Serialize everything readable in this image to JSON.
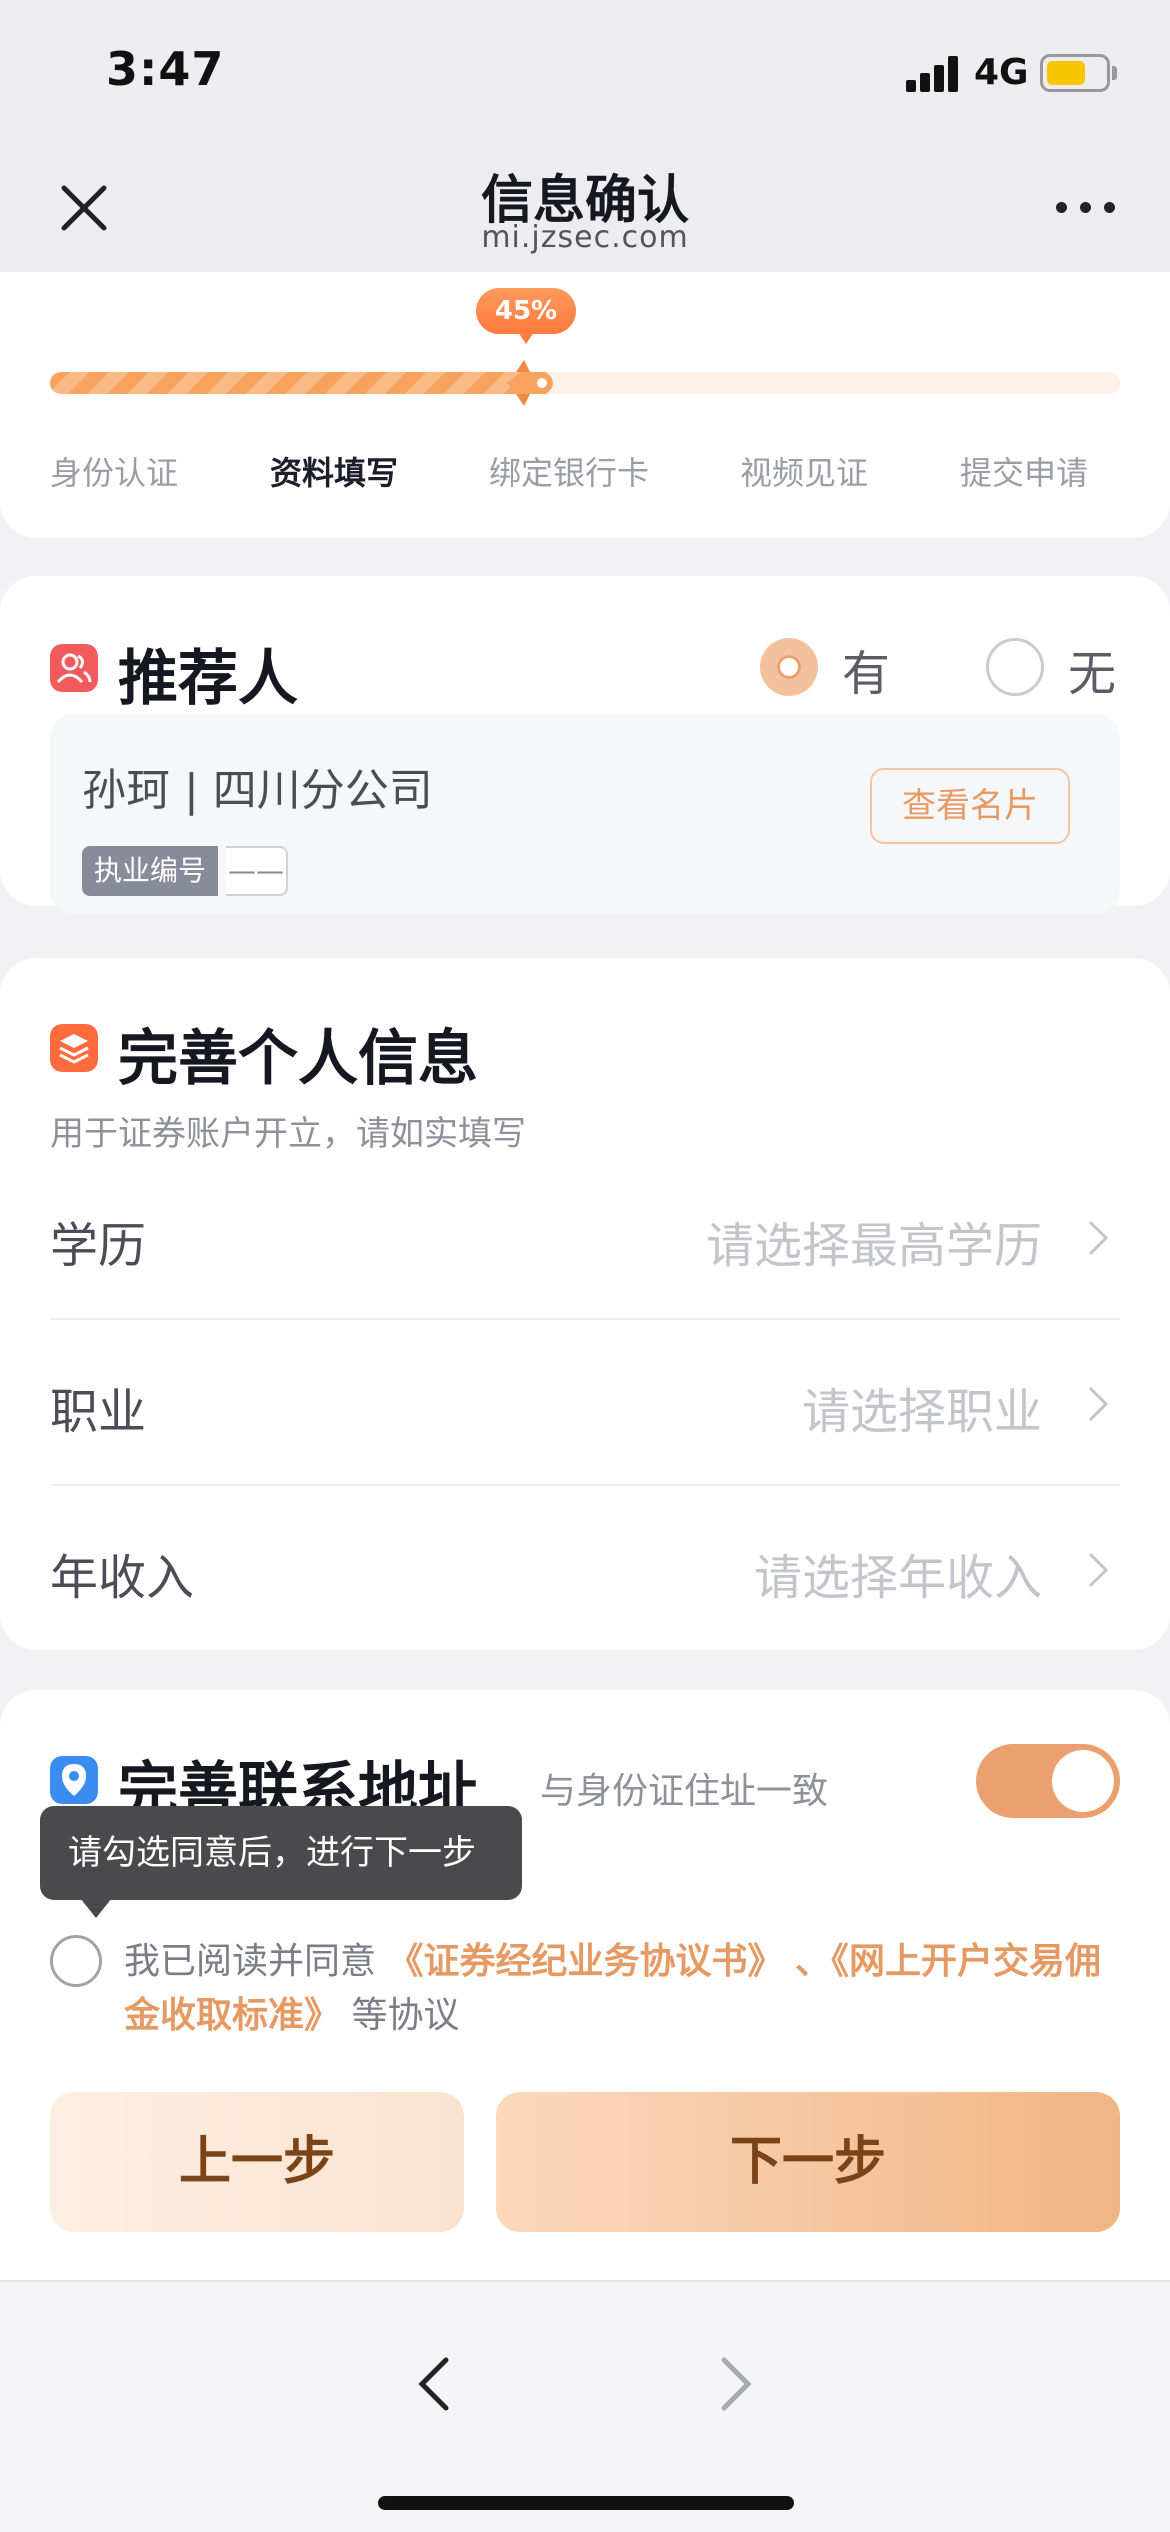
{
  "status_bar": {
    "time": "3:47",
    "network": "4G",
    "battery_color": "#f7c600"
  },
  "nav": {
    "title": "信息确认",
    "url": "mi.jzsec.com",
    "close_icon": "close-icon",
    "more_icon": "more-icon"
  },
  "progress": {
    "percent_label": "45%",
    "value": 0.45,
    "steps": [
      "身份认证",
      "资料填写",
      "绑定银行卡",
      "视频见证",
      "提交申请"
    ],
    "active_step": 1
  },
  "referrer": {
    "title": "推荐人",
    "option_yes": "有",
    "option_no": "无",
    "selected": "有",
    "name": "孙珂 | 四川分公司",
    "license_label": "执业编号",
    "license_value": "——",
    "view_card_button": "查看名片"
  },
  "personal_info": {
    "title": "完善个人信息",
    "subtitle": "用于证券账户开立，请如实填写",
    "rows": [
      {
        "label": "学历",
        "placeholder": "请选择最高学历"
      },
      {
        "label": "职业",
        "placeholder": "请选择职业"
      },
      {
        "label": "年收入",
        "placeholder": "请选择年收入"
      }
    ]
  },
  "address": {
    "title": "完善联系地址",
    "same_as_id_label": "与身份证住址一致",
    "same_as_id_enabled": true
  },
  "agreement": {
    "tooltip": "请勾选同意后，进行下一步",
    "prefix": "我已阅读并同意",
    "link1": "《证券经纪业务协议书》",
    "separator": "、",
    "link2": "《网上开户交易佣金收取标准》",
    "suffix": "等协议",
    "checked": false
  },
  "buttons": {
    "prev": "上一步",
    "next": "下一步"
  },
  "colors": {
    "accent": "#eba070",
    "accent_text": "#e59a63",
    "button_text": "#7a4318"
  }
}
